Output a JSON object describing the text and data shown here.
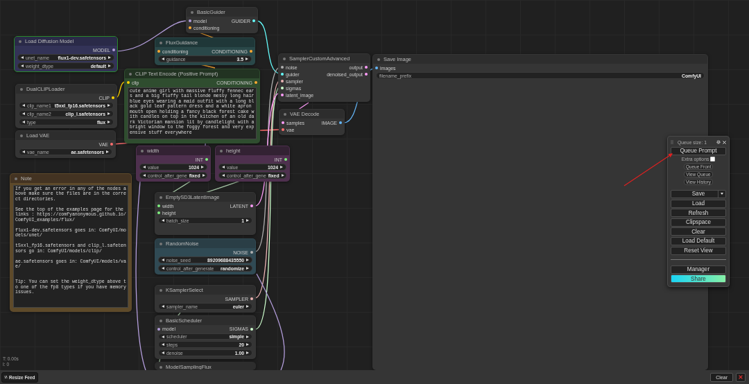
{
  "nodes": [
    {
      "title": "BasicGuider",
      "kind": "default",
      "selected": false,
      "inputs": [
        {
          "name": "model",
          "color": "#b39ddb"
        },
        {
          "name": "conditioning",
          "color": "#ffa931"
        }
      ],
      "outputs": [
        {
          "name": "GUIDER",
          "color": "#66ffff"
        }
      ]
    },
    {
      "title": "Load Diffusion Model",
      "kind": "model",
      "selected": true,
      "outputs": [
        {
          "name": "MODEL",
          "color": "#b39ddb"
        }
      ],
      "widgets": [
        {
          "label": "unet_name",
          "value": "flux1-dev.safetensors",
          "kind": "combo"
        },
        {
          "label": "weight_dtype",
          "value": "default",
          "kind": "combo"
        }
      ]
    },
    {
      "title": "FluxGuidance",
      "kind": "teal",
      "selected": false,
      "inputs": [
        {
          "name": "conditioning",
          "color": "#ffa931"
        }
      ],
      "outputs": [
        {
          "name": "CONDITIONING",
          "color": "#ffa931"
        }
      ],
      "widgets": [
        {
          "label": "guidance",
          "value": "3.5",
          "kind": "combo"
        }
      ]
    },
    {
      "title": "CLIP Text Encode (Positive Prompt)",
      "kind": "green",
      "selected": false,
      "inputs": [
        {
          "name": "clip",
          "color": "#ffd500"
        }
      ],
      "outputs": [
        {
          "name": "CONDITIONING",
          "color": "#ffa931"
        }
      ],
      "text": "cute anime girl with massive fluffy fennec ears and a big fluffy tail blonde messy long hair blue eyes wearing a maid outfit with a long black gold leaf pattern dress and a white apron mouth open holding a fancy black forest cake with candles on top in the kitchen of an old dark Victorian mansion lit by candlelight with a bright window to the foggy forest and very expensive stuff everywhere"
    },
    {
      "title": "DualCLIPLoader",
      "kind": "default",
      "selected": false,
      "outputs": [
        {
          "name": "CLIP",
          "color": "#ffd500"
        }
      ],
      "widgets": [
        {
          "label": "clip_name1",
          "value": "t5xxl_fp16.safetensors",
          "kind": "combo"
        },
        {
          "label": "clip_name2",
          "value": "clip_l.safetensors",
          "kind": "combo"
        },
        {
          "label": "type",
          "value": "flux",
          "kind": "combo"
        }
      ]
    },
    {
      "title": "Load VAE",
      "kind": "default",
      "selected": false,
      "outputs": [
        {
          "name": "VAE",
          "color": "#ff6e6e"
        }
      ],
      "widgets": [
        {
          "label": "vae_name",
          "value": "ae.safetensors",
          "kind": "combo"
        }
      ]
    },
    {
      "title": "SamplerCustomAdvanced",
      "kind": "default",
      "selected": false,
      "inputs": [
        {
          "name": "noise",
          "color": "#b0b0b0"
        },
        {
          "name": "guider",
          "color": "#66ffff"
        },
        {
          "name": "sampler",
          "color": "#ecb4b4"
        },
        {
          "name": "sigmas",
          "color": "#cdffcd"
        },
        {
          "name": "latent_image",
          "color": "#ff9cf9"
        }
      ],
      "outputs": [
        {
          "name": "output",
          "color": "#ff9cf9"
        },
        {
          "name": "denoised_output",
          "color": "#ff9cf9"
        }
      ]
    },
    {
      "title": "VAE Decode",
      "kind": "default",
      "selected": false,
      "inputs": [
        {
          "name": "samples",
          "color": "#ff9cf9"
        },
        {
          "name": "vae",
          "color": "#ff6e6e"
        }
      ],
      "outputs": [
        {
          "name": "IMAGE",
          "color": "#64b5f6"
        }
      ]
    },
    {
      "title": "Save Image",
      "kind": "default",
      "selected": false,
      "inputs": [
        {
          "name": "images",
          "color": "#64b5f6"
        }
      ],
      "widgets": [
        {
          "label": "filename_prefix",
          "value": "ComfyUI",
          "kind": "text"
        }
      ]
    },
    {
      "title": "width",
      "kind": "purple",
      "selected": false,
      "outputs": [
        {
          "name": "INT",
          "color": "#7ff07f"
        }
      ],
      "widgets": [
        {
          "label": "value",
          "value": "1024",
          "kind": "combo"
        },
        {
          "label": "control_after_gene",
          "value": "fixed",
          "kind": "combo"
        }
      ]
    },
    {
      "title": "height",
      "kind": "purple",
      "selected": false,
      "outputs": [
        {
          "name": "INT",
          "color": "#7ff07f"
        }
      ],
      "widgets": [
        {
          "label": "value",
          "value": "1024",
          "kind": "combo"
        },
        {
          "label": "control_after_gene",
          "value": "fixed",
          "kind": "combo"
        }
      ]
    },
    {
      "title": "Note",
      "kind": "brown",
      "selected": false,
      "text": "If you get an error in any of the nodes above make sure the files are in the correct directories.\n\nSee the top of the examples page for the links : https://comfyanonymous.github.io/ComfyUI_examples/flux/\n\nflux1-dev.safetensors goes in: ComfyUI/models/unet/\n\nt5xxl_fp16.safetensors and clip_l.safetensors go in: ComfyUI/models/clip/\n\nae.safetensors goes in: ComfyUI/models/vae/\n\n\nTip: You can set the weight_dtype above to one of the fp8 types if you have memory issues."
    },
    {
      "title": "EmptySD3LatentImage",
      "kind": "default",
      "selected": false,
      "inputs": [
        {
          "name": "width",
          "color": "#7ff07f"
        },
        {
          "name": "height",
          "color": "#7ff07f"
        }
      ],
      "outputs": [
        {
          "name": "LATENT",
          "color": "#ff9cf9"
        }
      ],
      "widgets": [
        {
          "label": "batch_size",
          "value": "1",
          "kind": "combo"
        }
      ]
    },
    {
      "title": "RandomNoise",
      "kind": "slate",
      "selected": false,
      "outputs": [
        {
          "name": "NOISE",
          "color": "#b0b0b0"
        }
      ],
      "widgets": [
        {
          "label": "noise_seed",
          "value": "89209688435550",
          "kind": "combo"
        },
        {
          "label": "control_after_generate",
          "value": "randomize",
          "kind": "combo"
        }
      ]
    },
    {
      "title": "KSamplerSelect",
      "kind": "default",
      "selected": false,
      "outputs": [
        {
          "name": "SAMPLER",
          "color": "#ecb4b4"
        }
      ],
      "widgets": [
        {
          "label": "sampler_name",
          "value": "euler",
          "kind": "combo"
        }
      ]
    },
    {
      "title": "BasicScheduler",
      "kind": "default",
      "selected": false,
      "inputs": [
        {
          "name": "model",
          "color": "#b39ddb"
        }
      ],
      "outputs": [
        {
          "name": "SIGMAS",
          "color": "#cdffcd"
        }
      ],
      "widgets": [
        {
          "label": "scheduler",
          "value": "simple",
          "kind": "combo"
        },
        {
          "label": "steps",
          "value": "20",
          "kind": "combo"
        },
        {
          "label": "denoise",
          "value": "1.00",
          "kind": "combo"
        }
      ]
    },
    {
      "title": "ModelSamplingFlux",
      "kind": "default",
      "selected": false
    }
  ],
  "menu": {
    "queue_size": "Queue size: 1",
    "queue_button": "Queue Prompt",
    "extra_options": {
      "label": "Extra options",
      "checked": false
    },
    "small_buttons": [
      "Queue Front",
      "View Queue",
      "View History"
    ],
    "buttons": [
      {
        "label": "Save",
        "kind": "dropdown"
      },
      {
        "label": "Load",
        "kind": "plain"
      },
      {
        "label": "Refresh",
        "kind": "plain"
      },
      {
        "label": "Clipspace",
        "kind": "plain"
      },
      {
        "label": "Clear",
        "kind": "plain"
      },
      {
        "label": "Load Default",
        "kind": "plain"
      },
      {
        "label": "Reset View",
        "kind": "plain"
      }
    ],
    "bottom_buttons": [
      {
        "label": "Manager",
        "kind": "plain"
      },
      {
        "label": "Share",
        "kind": "gradient"
      }
    ]
  },
  "stats": [
    "T: 0.00s",
    "I: 0"
  ],
  "bottom_bar": {
    "resize_button": "Resize Feed",
    "clear_button": "Clear"
  }
}
